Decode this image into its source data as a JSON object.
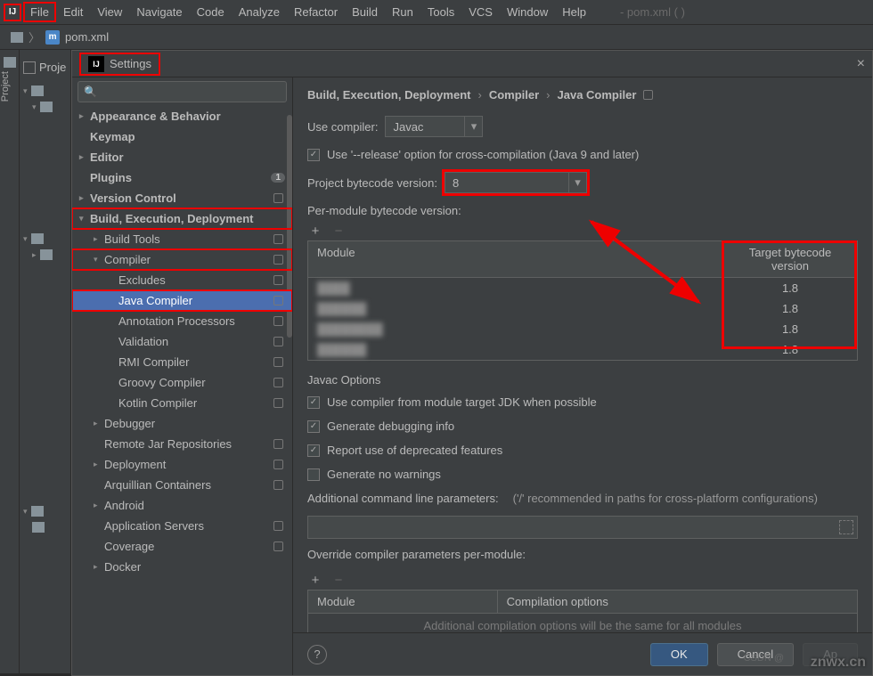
{
  "menubar": {
    "items": [
      "File",
      "Edit",
      "View",
      "Navigate",
      "Code",
      "Analyze",
      "Refactor",
      "Build",
      "Run",
      "Tools",
      "VCS",
      "Window",
      "Help"
    ],
    "title": "- pom.xml (      )"
  },
  "nav": {
    "file": "pom.xml"
  },
  "toolstrip": {
    "label": "Project"
  },
  "dialog": {
    "title": "Settings",
    "close": "×",
    "crumbs": [
      "Build, Execution, Deployment",
      "Compiler",
      "Java Compiler"
    ]
  },
  "tree": [
    {
      "label": "Appearance & Behavior",
      "bold": true,
      "arrow": ">",
      "indent": 0
    },
    {
      "label": "Keymap",
      "bold": true,
      "indent": 0
    },
    {
      "label": "Editor",
      "bold": true,
      "arrow": ">",
      "indent": 0
    },
    {
      "label": "Plugins",
      "bold": true,
      "indent": 0,
      "badge": "1",
      "cfg": true
    },
    {
      "label": "Version Control",
      "bold": true,
      "arrow": ">",
      "indent": 0,
      "cfg": true
    },
    {
      "label": "Build, Execution, Deployment",
      "bold": true,
      "arrow": "v",
      "indent": 0,
      "hl": true
    },
    {
      "label": "Build Tools",
      "arrow": ">",
      "indent": 1,
      "cfg": true
    },
    {
      "label": "Compiler",
      "arrow": "v",
      "indent": 1,
      "cfg": true,
      "hl": true
    },
    {
      "label": "Excludes",
      "indent": 2,
      "cfg": true
    },
    {
      "label": "Java Compiler",
      "indent": 2,
      "cfg": true,
      "sel": true,
      "hl": true
    },
    {
      "label": "Annotation Processors",
      "indent": 2,
      "cfg": true
    },
    {
      "label": "Validation",
      "indent": 2,
      "cfg": true
    },
    {
      "label": "RMI Compiler",
      "indent": 2,
      "cfg": true
    },
    {
      "label": "Groovy Compiler",
      "indent": 2,
      "cfg": true
    },
    {
      "label": "Kotlin Compiler",
      "indent": 2,
      "cfg": true
    },
    {
      "label": "Debugger",
      "arrow": ">",
      "indent": 1
    },
    {
      "label": "Remote Jar Repositories",
      "indent": 1,
      "cfg": true
    },
    {
      "label": "Deployment",
      "arrow": ">",
      "indent": 1,
      "cfg": true
    },
    {
      "label": "Arquillian Containers",
      "indent": 1,
      "cfg": true
    },
    {
      "label": "Android",
      "arrow": ">",
      "indent": 1
    },
    {
      "label": "Application Servers",
      "indent": 1,
      "cfg": true
    },
    {
      "label": "Coverage",
      "indent": 1,
      "cfg": true
    },
    {
      "label": "Docker",
      "arrow": ">",
      "indent": 1
    }
  ],
  "form": {
    "use_compiler_label": "Use compiler:",
    "use_compiler_value": "Javac",
    "release_opt": "Use '--release' option for cross-compilation (Java 9 and later)",
    "proj_bc_label": "Project bytecode version:",
    "proj_bc_value": "8",
    "per_module_label": "Per-module bytecode version:",
    "add": "+",
    "remove": "−",
    "col_module": "Module",
    "col_target": "Target bytecode version",
    "modules": [
      {
        "name": "████",
        "target": "1.8"
      },
      {
        "name": "██████",
        "target": "1.8"
      },
      {
        "name": "████████",
        "target": "1.8"
      },
      {
        "name": "██████",
        "target": "1.8"
      }
    ],
    "javac_title": "Javac Options",
    "opt1": "Use compiler from module target JDK when possible",
    "opt2": "Generate debugging info",
    "opt3": "Report use of deprecated features",
    "opt4": "Generate no warnings",
    "addl_params_label": "Additional command line parameters:",
    "addl_params_hint": "('/' recommended in paths for cross-platform configurations)",
    "override_label": "Override compiler parameters per-module:",
    "col2_module": "Module",
    "col2_opts": "Compilation options",
    "table2_placeholder": "Additional compilation options will be the same for all modules"
  },
  "footer": {
    "ok": "OK",
    "cancel": "Cancel"
  },
  "watermark": "znwx.cn",
  "watermark2": "CSDN @"
}
